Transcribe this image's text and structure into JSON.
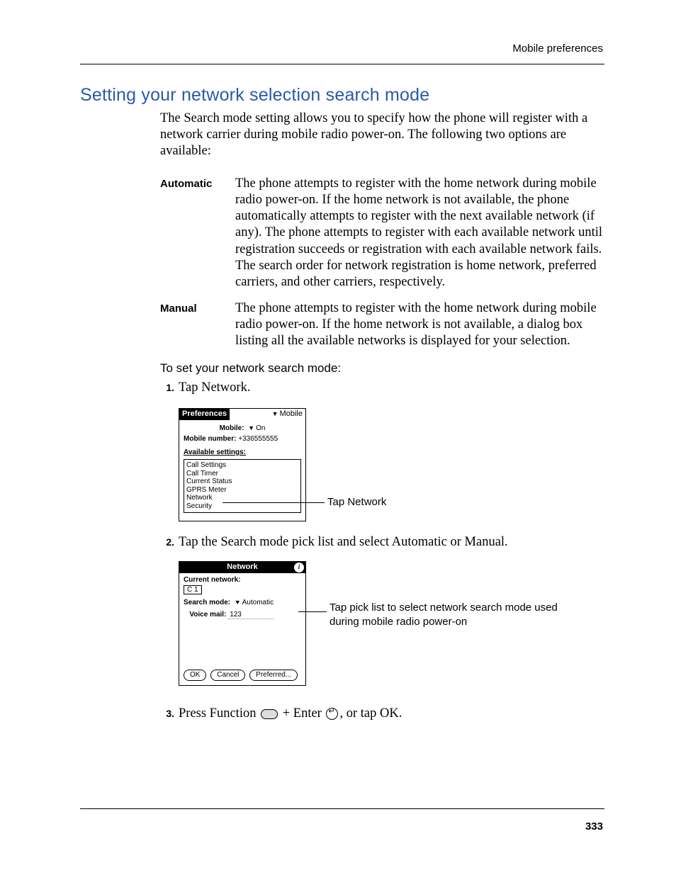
{
  "header": "Mobile preferences",
  "title": "Setting your network selection search mode",
  "intro": "The Search mode setting allows you to specify how the phone will register with a network carrier during mobile radio power-on. The following two options are available:",
  "defs": {
    "automatic": {
      "term": "Automatic",
      "desc": "The phone attempts to register with the home network during mobile radio power-on. If the home network is not available, the phone automatically attempts to register with the next available network (if any). The phone attempts to register with each available network until registration succeeds or registration with each available network fails. The search order for network registration is home network, preferred carriers, and other carriers, respectively."
    },
    "manual": {
      "term": "Manual",
      "desc": "The phone attempts to register with the home network during mobile radio power-on. If the home network is not available, a dialog box listing all the available networks is displayed for your selection."
    }
  },
  "subhead": "To set your network search mode:",
  "steps": {
    "s1": {
      "num": "1.",
      "text": "Tap Network."
    },
    "s2": {
      "num": "2.",
      "text": "Tap the Search mode pick list and select Automatic or Manual."
    },
    "s3": {
      "num": "3.",
      "pre": "Press Function ",
      "mid": " + Enter ",
      "post": ", or tap OK."
    }
  },
  "shot1": {
    "title_left": "Preferences",
    "title_right": "Mobile",
    "mobile_label": "Mobile:",
    "mobile_value": "On",
    "number_label": "Mobile number:",
    "number_value": "+336555555",
    "available_label": "Available settings:",
    "items": {
      "i0": "Call Settings",
      "i1": "Call Timer",
      "i2": "Current Status",
      "i3": "GPRS Meter",
      "i4": "Network",
      "i5": "Security"
    }
  },
  "callout1": "Tap Network",
  "shot2": {
    "title": "Network",
    "current_label": "Current network:",
    "current_value": "C 1",
    "search_label": "Search mode:",
    "search_value": "Automatic",
    "vm_label": "Voice mail:",
    "vm_value": "123",
    "btn_ok": "OK",
    "btn_cancel": "Cancel",
    "btn_pref": "Preferred..."
  },
  "callout2": "Tap pick list to select network search mode used during mobile radio power-on",
  "pagenum": "333"
}
